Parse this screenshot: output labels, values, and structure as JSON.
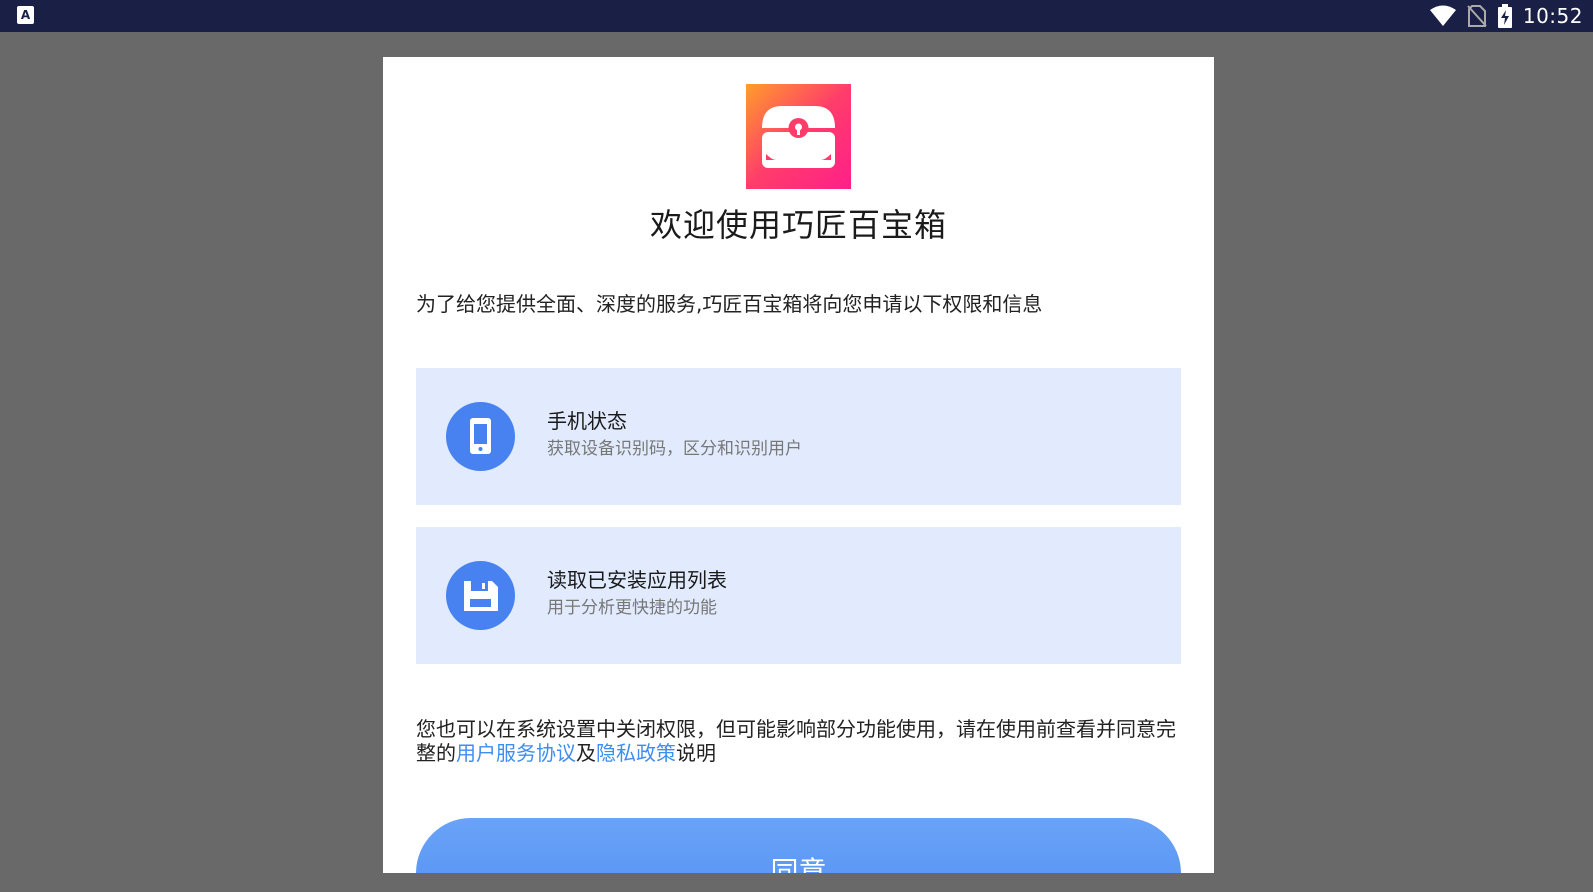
{
  "status_bar": {
    "time": "10:52",
    "left_icon_letter": "A",
    "icons": [
      "wifi-icon",
      "no-sim-icon",
      "battery-charging-icon"
    ]
  },
  "dialog": {
    "app_icon": "treasure-chest-icon",
    "title": "欢迎使用巧匠百宝箱",
    "intro": "为了给您提供全面、深度的服务,巧匠百宝箱将向您申请以下权限和信息",
    "permissions": [
      {
        "icon": "phone-icon",
        "title": "手机状态",
        "desc": "获取设备识别码，区分和识别用户"
      },
      {
        "icon": "save-icon",
        "title": "读取已安装应用列表",
        "desc": "用于分析更快捷的功能"
      }
    ],
    "notice": {
      "prefix": "您也可以在系统设置中关闭权限，但可能影响部分功能使用，请在使用前查看并同意完整的",
      "link_terms": "用户服务协议",
      "middle": "及",
      "link_privacy": "隐私政策",
      "suffix": "说明"
    },
    "agree_label": "同意"
  },
  "colors": {
    "accent": "#4782f0",
    "link": "#3e8ef0",
    "card_bg": "#e1ebfd",
    "status_bar_bg": "#1a2045"
  }
}
